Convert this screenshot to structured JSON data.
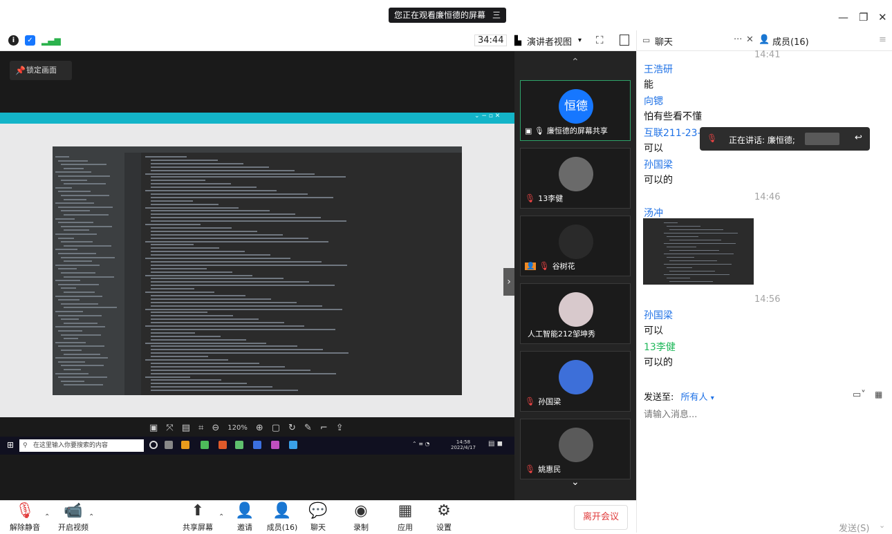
{
  "window": {
    "share_banner": "您正在观看廉恒德的屏幕",
    "banner_menu_icon": "三",
    "minimize": "—",
    "restore": "❐",
    "close": "✕"
  },
  "toolbar": {
    "timer": "34:44",
    "view_mode": "演讲者视图",
    "chat_tab": "聊天",
    "more": "···",
    "close_chat": "✕",
    "members_tab": "成员(16)"
  },
  "stage": {
    "lock_label": "锁定画面",
    "viewer_zoom": "120%",
    "taskbar_search": "在这里输入你要搜索的内容",
    "clock_time": "14:58",
    "clock_date": "2022/4/17"
  },
  "participants": [
    {
      "name": "廉恒德的屏幕共享",
      "avatar_text": "恒德",
      "avatar_color": "#1677ff",
      "muted": false,
      "active": true
    },
    {
      "name": "13李健",
      "avatar_text": "",
      "avatar_color": "#6a6a6a",
      "muted": true
    },
    {
      "name": "谷树花",
      "avatar_text": "",
      "avatar_color": "#2a2a2a",
      "muted": true,
      "badge": true
    },
    {
      "name": "人工智能212邹坤秀",
      "avatar_text": "",
      "avatar_color": "#d8c9cc",
      "muted": false
    },
    {
      "name": "孙国梁",
      "avatar_text": "",
      "avatar_color": "#3d6fd9",
      "muted": true
    },
    {
      "name": "姚惠民",
      "avatar_text": "",
      "avatar_color": "#5a5a5a",
      "muted": true
    }
  ],
  "chat": {
    "top_time": "14:41",
    "messages": [
      {
        "sender": "王浩研",
        "text": "能",
        "color": "blue"
      },
      {
        "sender": "向锶",
        "text": "怕有些看不懂",
        "color": "blue"
      },
      {
        "sender": "互联211-23-",
        "text": "可以",
        "color": "blue"
      },
      {
        "sender": "孙国梁",
        "text": "可以的",
        "color": "blue"
      }
    ],
    "time_2": "14:46",
    "image_sender": "汤冲",
    "time_3": "14:56",
    "messages_2": [
      {
        "sender": "孙国梁",
        "text": "可以",
        "color": "blue"
      },
      {
        "sender": "13李健",
        "text": "可以的",
        "color": "green"
      }
    ],
    "speaking_label": "正在讲话: 廉恒德;",
    "send_to_label": "发送至:",
    "send_to_value": "所有人",
    "input_placeholder": "请输入消息...",
    "send_button": "发送(S)"
  },
  "controls": {
    "mute": "解除静音",
    "video": "开启视频",
    "share": "共享屏幕",
    "invite": "邀请",
    "members": "成员(16)",
    "chat": "聊天",
    "record": "录制",
    "apps": "应用",
    "settings": "设置",
    "leave": "离开会议"
  }
}
